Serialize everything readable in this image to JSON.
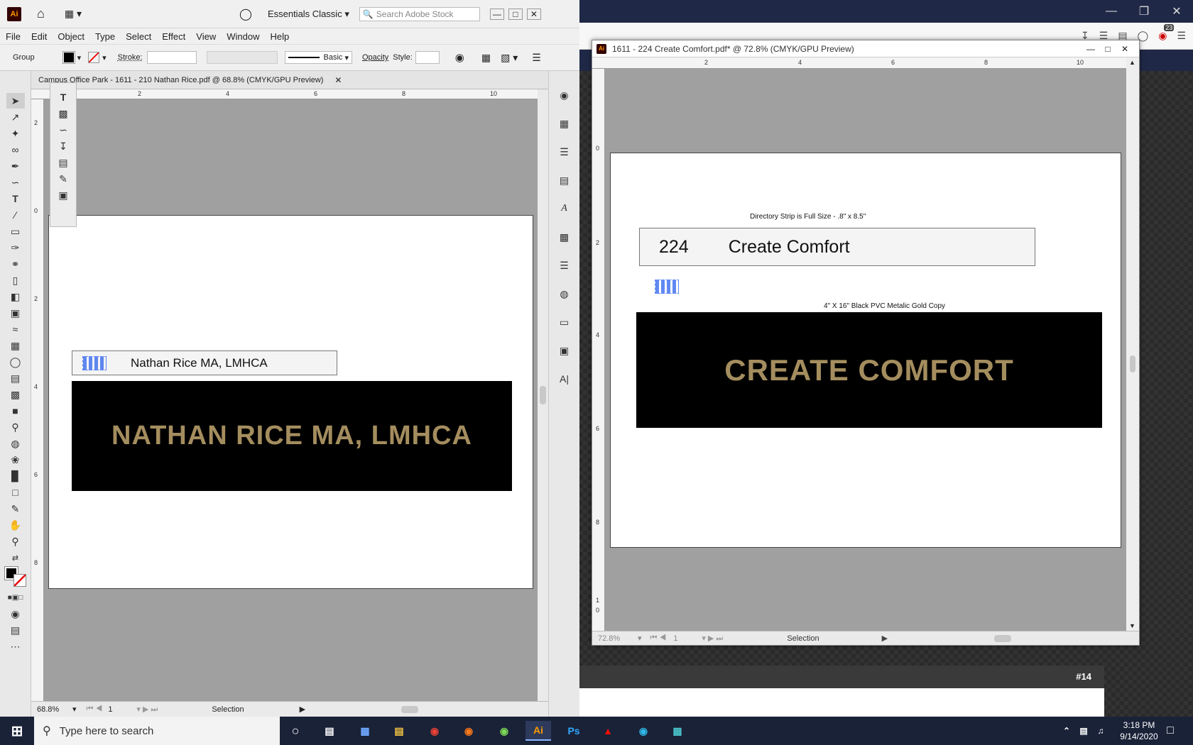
{
  "left_window": {
    "search_placeholder": "Search Adobe Stock",
    "workspace": "Essentials Classic",
    "menu": [
      "File",
      "Edit",
      "Object",
      "Type",
      "Select",
      "Effect",
      "View",
      "Window",
      "Help"
    ],
    "control": {
      "selection_type": "Group",
      "stroke_label": "Stroke:",
      "brush": "Basic",
      "opacity_label": "Opacity",
      "style_label": "Style:"
    },
    "doc_tab": "Campus Office Park  -  1611 - 210 Nathan Rice.pdf @ 68.8% (CMYK/GPU Preview)",
    "strip_text": "Nathan Rice MA, LMHCA",
    "plate_text": "NATHAN RICE MA, LMHCA",
    "status": {
      "zoom": "68.8%",
      "page": "1",
      "mode": "Selection"
    },
    "ruler_top": [
      "2",
      "4",
      "6",
      "8",
      "10"
    ],
    "ruler_left": [
      "2",
      "0",
      "2",
      "4",
      "6",
      "8"
    ]
  },
  "right_window": {
    "title": "1611  -  224  Create Comfort.pdf* @ 72.8% (CMYK/GPU Preview)",
    "strip_note": "Directory Strip is Full Size  -  .8\" x 8.5\"",
    "strip_number": "224",
    "strip_name": "Create Comfort",
    "plate_note": "4\" X 16\" Black PVC Metalic Gold Copy",
    "plate_text": "CREATE COMFORT",
    "status": {
      "zoom": "72.8%",
      "page": "1",
      "mode": "Selection"
    },
    "ruler_top": [
      "2",
      "4",
      "6",
      "8",
      "10"
    ],
    "ruler_left": [
      "0",
      "2",
      "4",
      "6",
      "8",
      "1",
      "0"
    ]
  },
  "background": {
    "badge": "23",
    "card_label": "#14"
  },
  "taskbar": {
    "search_placeholder": "Type here to search",
    "time": "3:18 PM",
    "date": "9/14/2020"
  },
  "colors": {
    "gold": "#a48d5e",
    "selection_blue": "#3a6cf0",
    "taskbar": "#1a2238"
  }
}
